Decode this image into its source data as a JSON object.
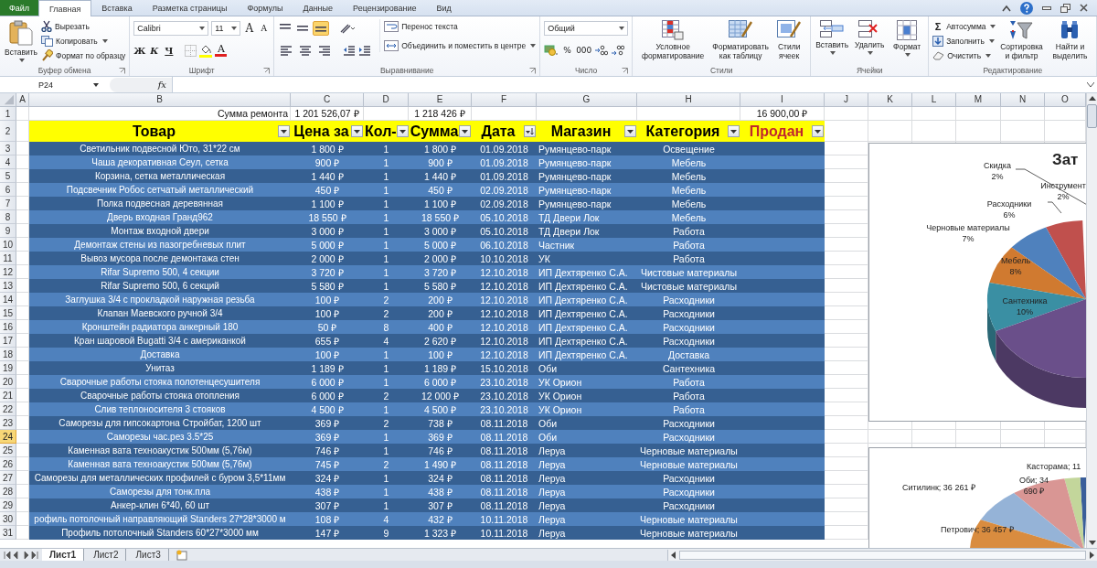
{
  "ribbon_tabs": [
    {
      "label": "Файл",
      "kind": "file",
      "selected": false
    },
    {
      "label": "Главная",
      "kind": "tab",
      "selected": true
    },
    {
      "label": "Вставка",
      "kind": "tab",
      "selected": false
    },
    {
      "label": "Разметка страницы",
      "kind": "tab",
      "selected": false
    },
    {
      "label": "Формулы",
      "kind": "tab",
      "selected": false
    },
    {
      "label": "Данные",
      "kind": "tab",
      "selected": false
    },
    {
      "label": "Рецензирование",
      "kind": "tab",
      "selected": false
    },
    {
      "label": "Вид",
      "kind": "tab",
      "selected": false
    }
  ],
  "ribbon": {
    "clipboard": {
      "title": "Буфер обмена",
      "paste": "Вставить",
      "cut": "Вырезать",
      "copy": "Копировать",
      "format_painter": "Формат по образцу"
    },
    "font": {
      "title": "Шрифт",
      "font_name": "Calibri",
      "font_size": "11",
      "grow": "A",
      "shrink": "A",
      "bold": "Ж",
      "italic": "К",
      "underline": "Ч",
      "font_color": "A"
    },
    "alignment": {
      "title": "Выравнивание",
      "vertical_align": [
        {
          "selected": false
        },
        {
          "selected": false
        },
        {
          "selected": true
        }
      ],
      "wrap": "Перенос текста",
      "merge": "Объединить и поместить в центре"
    },
    "number": {
      "title": "Число",
      "format": "Общий",
      "percent": "%",
      "thousands": "000"
    },
    "styles": {
      "title": "Стили",
      "conditional": "Условное форматирование",
      "as_table": "Форматировать как таблицу",
      "cell_styles": "Стили ячеек"
    },
    "cells": {
      "title": "Ячейки",
      "insert": "Вставить",
      "delete": "Удалить",
      "format": "Формат"
    },
    "editing": {
      "title": "Редактирование",
      "sigma": "Σ",
      "autosum": "Автосумма",
      "fill": "Заполнить",
      "clear": "Очистить",
      "sort": "Сортировка и фильтр",
      "find": "Найти и выделить"
    }
  },
  "formula_bar": {
    "name_box": "P24",
    "fx": "fx"
  },
  "sheet": {
    "column_letters": [
      "A",
      "B",
      "C",
      "D",
      "E",
      "F",
      "G",
      "H",
      "I",
      "J",
      "K",
      "L",
      "M",
      "N",
      "O"
    ],
    "row_headers": [
      {
        "label": "1",
        "selected": false
      },
      {
        "label": "2",
        "selected": false
      },
      {
        "label": "3",
        "selected": false
      },
      {
        "label": "4",
        "selected": false
      },
      {
        "label": "5",
        "selected": false
      },
      {
        "label": "6",
        "selected": false
      },
      {
        "label": "7",
        "selected": false
      },
      {
        "label": "8",
        "selected": false
      },
      {
        "label": "9",
        "selected": false
      },
      {
        "label": "10",
        "selected": false
      },
      {
        "label": "11",
        "selected": false
      },
      {
        "label": "12",
        "selected": false
      },
      {
        "label": "13",
        "selected": false
      },
      {
        "label": "14",
        "selected": false
      },
      {
        "label": "15",
        "selected": false
      },
      {
        "label": "16",
        "selected": false
      },
      {
        "label": "17",
        "selected": false
      },
      {
        "label": "18",
        "selected": false
      },
      {
        "label": "19",
        "selected": false
      },
      {
        "label": "20",
        "selected": false
      },
      {
        "label": "21",
        "selected": false
      },
      {
        "label": "22",
        "selected": false
      },
      {
        "label": "23",
        "selected": false
      },
      {
        "label": "24",
        "selected": true
      },
      {
        "label": "25",
        "selected": false
      },
      {
        "label": "26",
        "selected": false
      },
      {
        "label": "27",
        "selected": false
      },
      {
        "label": "28",
        "selected": false
      },
      {
        "label": "29",
        "selected": false
      },
      {
        "label": "30",
        "selected": false
      },
      {
        "label": "31",
        "selected": false
      }
    ],
    "summary": {
      "label": "Сумма ремонта",
      "total_price": "1 201 526,07 ₽",
      "total_sum": "1 218 426 ₽",
      "sold": "16 900,00 ₽"
    },
    "headers": [
      {
        "label": "Товар",
        "kind": "filter",
        "highlighted": false
      },
      {
        "label": "Цена за",
        "kind": "filter",
        "highlighted": false
      },
      {
        "label": "Кол-",
        "kind": "filter",
        "highlighted": false
      },
      {
        "label": "Сумма",
        "kind": "filter",
        "highlighted": false
      },
      {
        "label": "Дата",
        "kind": "sorted",
        "highlighted": false
      },
      {
        "label": "Магазин",
        "kind": "filter",
        "highlighted": false
      },
      {
        "label": "Категория",
        "kind": "filter",
        "highlighted": false
      },
      {
        "label": "Продан",
        "kind": "filter",
        "highlighted": true
      }
    ],
    "rows": [
      [
        "Светильник подвесной Юто, 31*22 см",
        "1 800 ₽",
        "1",
        "1 800 ₽",
        "01.09.2018",
        "Румянцево-парк",
        "Освещение"
      ],
      [
        "Чаша декоративная Сеул, сетка",
        "900 ₽",
        "1",
        "900 ₽",
        "01.09.2018",
        "Румянцево-парк",
        "Мебель"
      ],
      [
        "Корзина, сетка металлическая",
        "1 440 ₽",
        "1",
        "1 440 ₽",
        "01.09.2018",
        "Румянцево-парк",
        "Мебель"
      ],
      [
        "Подсвечник Робос сетчатый металлический",
        "450 ₽",
        "1",
        "450 ₽",
        "02.09.2018",
        "Румянцево-парк",
        "Мебель"
      ],
      [
        "Полка подвесная деревянная",
        "1 100 ₽",
        "1",
        "1 100 ₽",
        "02.09.2018",
        "Румянцево-парк",
        "Мебель"
      ],
      [
        "Дверь входная Гранд962",
        "18 550 ₽",
        "1",
        "18 550 ₽",
        "05.10.2018",
        "ТД Двери Лок",
        "Мебель"
      ],
      [
        "Монтаж входной двери",
        "3 000 ₽",
        "1",
        "3 000 ₽",
        "05.10.2018",
        "ТД Двери Лок",
        "Работа"
      ],
      [
        "Демонтаж стены из пазогребневых плит",
        "5 000 ₽",
        "1",
        "5 000 ₽",
        "06.10.2018",
        "Частник",
        "Работа"
      ],
      [
        "Вывоз мусора после демонтажа стен",
        "2 000 ₽",
        "1",
        "2 000 ₽",
        "10.10.2018",
        "УК",
        "Работа"
      ],
      [
        "Rifar Supremo 500, 4 секции",
        "3 720 ₽",
        "1",
        "3 720 ₽",
        "12.10.2018",
        "ИП Дехтяренко С.А.",
        "Чистовые материалы"
      ],
      [
        "Rifar Supremo 500, 6 секций",
        "5 580 ₽",
        "1",
        "5 580 ₽",
        "12.10.2018",
        "ИП Дехтяренко С.А.",
        "Чистовые материалы"
      ],
      [
        "Заглушка 3/4 с прокладкой наружная резьба",
        "100 ₽",
        "2",
        "200 ₽",
        "12.10.2018",
        "ИП Дехтяренко С.А.",
        "Расходники"
      ],
      [
        "Клапан Маевского ручной 3/4",
        "100 ₽",
        "2",
        "200 ₽",
        "12.10.2018",
        "ИП Дехтяренко С.А.",
        "Расходники"
      ],
      [
        "Кронштейн радиатора анкерный 180",
        "50 ₽",
        "8",
        "400 ₽",
        "12.10.2018",
        "ИП Дехтяренко С.А.",
        "Расходники"
      ],
      [
        "Кран шаровой Bugatti 3/4 с американкой",
        "655 ₽",
        "4",
        "2 620 ₽",
        "12.10.2018",
        "ИП Дехтяренко С.А.",
        "Расходники"
      ],
      [
        "Доставка",
        "100 ₽",
        "1",
        "100 ₽",
        "12.10.2018",
        "ИП Дехтяренко С.А.",
        "Доставка"
      ],
      [
        "Унитаз",
        "1 189 ₽",
        "1",
        "1 189 ₽",
        "15.10.2018",
        "Оби",
        "Сантехника"
      ],
      [
        "Сварочные работы стояка полотенцесушителя",
        "6 000 ₽",
        "1",
        "6 000 ₽",
        "23.10.2018",
        "УК Орион",
        "Работа"
      ],
      [
        "Сварочные работы стояка отопления",
        "6 000 ₽",
        "2",
        "12 000 ₽",
        "23.10.2018",
        "УК Орион",
        "Работа"
      ],
      [
        "Слив теплоносителя 3 стояков",
        "4 500 ₽",
        "1",
        "4 500 ₽",
        "23.10.2018",
        "УК Орион",
        "Работа"
      ],
      [
        "Саморезы для гипсокартона Стройбат, 1200 шт",
        "369 ₽",
        "2",
        "738 ₽",
        "08.11.2018",
        "Оби",
        "Расходники"
      ],
      [
        "Саморезы час.рез 3.5*25",
        "369 ₽",
        "1",
        "369 ₽",
        "08.11.2018",
        "Оби",
        "Расходники"
      ],
      [
        "Каменная вата техноакустик 500мм (5,76м)",
        "746 ₽",
        "1",
        "746 ₽",
        "08.11.2018",
        "Леруа",
        "Черновые материалы"
      ],
      [
        "Каменная вата техноакустик 500мм (5,76м)",
        "745 ₽",
        "2",
        "1 490 ₽",
        "08.11.2018",
        "Леруа",
        "Черновые материалы"
      ],
      [
        "Саморезы для металлических профилей с буром 3,5*11мм",
        "324 ₽",
        "1",
        "324 ₽",
        "08.11.2018",
        "Леруа",
        "Расходники"
      ],
      [
        "Саморезы для тонк.пла",
        "438 ₽",
        "1",
        "438 ₽",
        "08.11.2018",
        "Леруа",
        "Расходники"
      ],
      [
        "Анкер-клин 6*40, 60 шт",
        "307 ₽",
        "1",
        "307 ₽",
        "08.11.2018",
        "Леруа",
        "Расходники"
      ],
      [
        "рофиль потолочный направляющий Standers 27*28*3000 м",
        "108 ₽",
        "4",
        "432 ₽",
        "10.11.2018",
        "Леруа",
        "Черновые материалы"
      ],
      [
        "Профиль потолочный Standers 60*27*3000 мм",
        "147 ₽",
        "9",
        "1 323 ₽",
        "10.11.2018",
        "Леруа",
        "Черновые материалы"
      ]
    ]
  },
  "charts": [
    {
      "title": "Зат",
      "labels": [
        {
          "text": "Скидка",
          "value": "2%"
        },
        {
          "text": "Инструмент",
          "value": "2%"
        },
        {
          "text": "Расходники",
          "value": "6%"
        },
        {
          "text": "Черновые материалы",
          "value": "7%"
        },
        {
          "text": "Мебель",
          "value": "8%"
        },
        {
          "text": "Сантехника",
          "value": "10%"
        }
      ]
    },
    {
      "labels": [
        {
          "text": "Касторама; 11"
        },
        {
          "text": "Ситилинк; 36 261 ₽"
        },
        {
          "text": "Оби; 34 690 ₽"
        },
        {
          "text": "Петрович; 36 457 ₽"
        }
      ]
    }
  ],
  "sheet_tabs": [
    {
      "label": "Лист1",
      "selected": true
    },
    {
      "label": "Лист2",
      "selected": false
    },
    {
      "label": "Лист3",
      "selected": false
    }
  ]
}
